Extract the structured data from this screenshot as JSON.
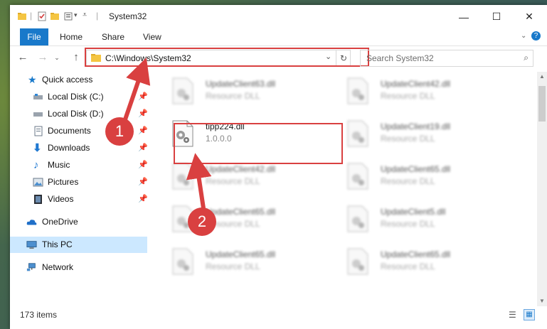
{
  "window": {
    "title": "System32"
  },
  "ribbon": {
    "tabs": [
      "File",
      "Home",
      "Share",
      "View"
    ]
  },
  "address": {
    "path": "C:\\Windows\\System32"
  },
  "search": {
    "placeholder": "Search System32"
  },
  "sidebar": {
    "items": [
      {
        "label": "Quick access",
        "icon": "star-icon"
      },
      {
        "label": "Local Disk (C:)",
        "icon": "drive-icon"
      },
      {
        "label": "Local Disk (D:)",
        "icon": "drive-icon"
      },
      {
        "label": "Documents",
        "icon": "documents-icon"
      },
      {
        "label": "Downloads",
        "icon": "download-icon"
      },
      {
        "label": "Music",
        "icon": "music-icon"
      },
      {
        "label": "Pictures",
        "icon": "pictures-icon"
      },
      {
        "label": "Videos",
        "icon": "videos-icon"
      },
      {
        "label": "OneDrive",
        "icon": "cloud-icon"
      },
      {
        "label": "This PC",
        "icon": "computer-icon"
      },
      {
        "label": "Network",
        "icon": "network-icon"
      }
    ]
  },
  "files": [
    {
      "name": "UpdateClient63.dll",
      "type": "Resource DLL"
    },
    {
      "name": "UpdateClient42.dll",
      "type": "Resource DLL"
    },
    {
      "name": "tipp224.dll",
      "type": "1.0.0.0"
    },
    {
      "name": "UpdateClient19.dll",
      "type": "Resource DLL"
    },
    {
      "name": "UpdateClient42.dll",
      "type": "Resource DLL"
    },
    {
      "name": "UpdateClient65.dll",
      "type": "Resource DLL"
    },
    {
      "name": "UpdateClient65.dll",
      "type": "Resource DLL"
    },
    {
      "name": "UpdateClient5.dll",
      "type": "Resource DLL"
    },
    {
      "name": "UpdateClient65.dll",
      "type": "Resource DLL"
    },
    {
      "name": "UpdateClient65.dll",
      "type": "Resource DLL"
    }
  ],
  "status": {
    "count": "173 items"
  },
  "annotations": {
    "step1": "1",
    "step2": "2"
  },
  "colors": {
    "accent": "#1979ca",
    "highlight": "#d94040",
    "selected": "#cce8ff"
  }
}
